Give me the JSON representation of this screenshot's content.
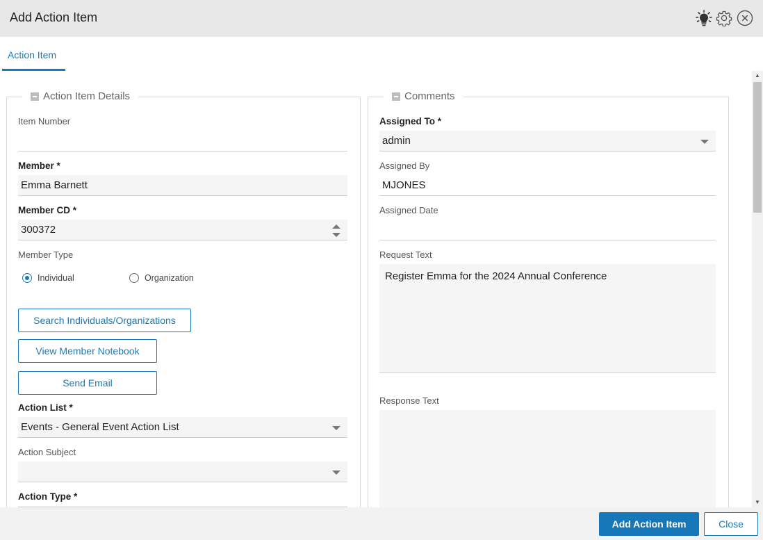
{
  "window": {
    "title": "Add Action Item"
  },
  "header_icons": [
    "lightbulb-icon",
    "gear-icon",
    "close-icon"
  ],
  "tabs": [
    {
      "label": "Action Item",
      "active": true
    }
  ],
  "details": {
    "legend": "Action Item Details",
    "item_number": {
      "label": "Item Number",
      "value": ""
    },
    "member": {
      "label": "Member *",
      "value": "Emma Barnett"
    },
    "member_cd": {
      "label": "Member CD *",
      "value": "300372"
    },
    "member_type": {
      "label": "Member Type",
      "options": [
        {
          "label": "Individual",
          "selected": true
        },
        {
          "label": "Organization",
          "selected": false
        }
      ]
    },
    "buttons": {
      "search": "Search Individuals/Organizations",
      "notebook": "View Member Notebook",
      "email": "Send Email"
    },
    "action_list": {
      "label": "Action List *",
      "value": "Events - General Event Action List"
    },
    "action_subject": {
      "label": "Action Subject",
      "value": ""
    },
    "action_type": {
      "label": "Action Type *",
      "value": ""
    }
  },
  "comments": {
    "legend": "Comments",
    "assigned_to": {
      "label": "Assigned To *",
      "value": "admin"
    },
    "assigned_by": {
      "label": "Assigned By",
      "value": "MJONES"
    },
    "assigned_date": {
      "label": "Assigned Date",
      "value": ""
    },
    "request_text": {
      "label": "Request Text",
      "value": "Register Emma for the 2024 Annual Conference"
    },
    "response_text": {
      "label": "Response Text",
      "value": ""
    }
  },
  "footer": {
    "primary_label": "Add Action Item",
    "secondary_label": "Close"
  },
  "colors": {
    "accent": "#1a7ab8",
    "primary_button": "#1777b8",
    "title_bar": "#e8e8e8",
    "field_bg": "#f5f5f5"
  }
}
